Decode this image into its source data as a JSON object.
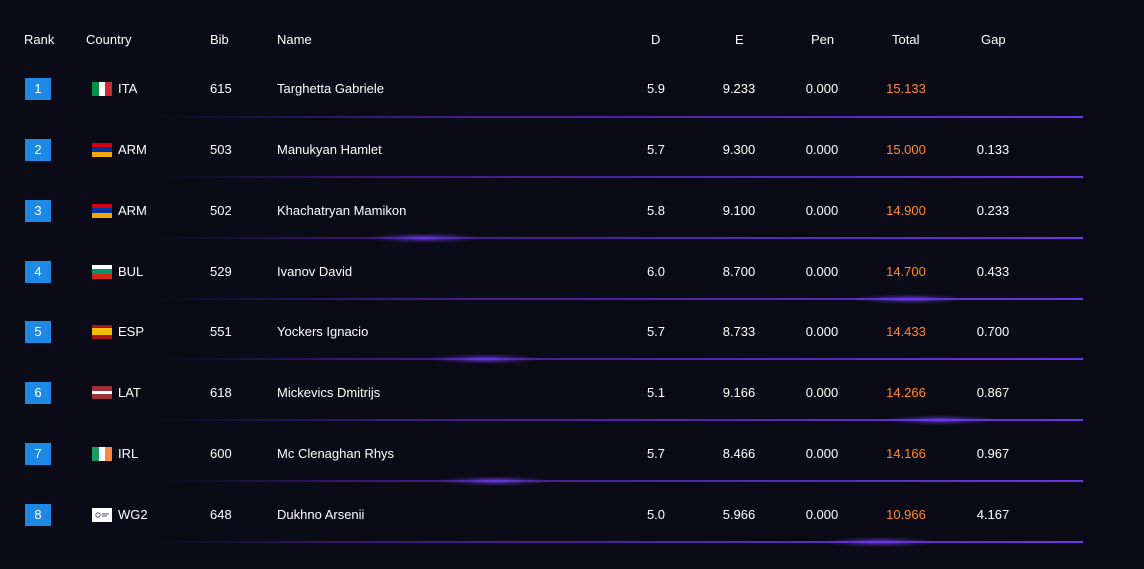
{
  "columns": {
    "rank": "Rank",
    "country": "Country",
    "bib": "Bib",
    "name": "Name",
    "d": "D",
    "e": "E",
    "pen": "Pen",
    "total": "Total",
    "gap": "Gap"
  },
  "colors": {
    "background": "#0b0b17",
    "rank_badge": "#1e88e5",
    "total_text": "#ff8a2b",
    "divider": "#6a35e8"
  },
  "rows": [
    {
      "rank": "1",
      "flag": "ITA-flag-icon",
      "country": "ITA",
      "bib": "615",
      "name": "Targhetta Gabriele",
      "d": "5.9",
      "e": "9.233",
      "pen": "0.000",
      "total": "15.133",
      "gap": ""
    },
    {
      "rank": "2",
      "flag": "ARM-flag-icon",
      "country": "ARM",
      "bib": "503",
      "name": "Manukyan Hamlet",
      "d": "5.7",
      "e": "9.300",
      "pen": "0.000",
      "total": "15.000",
      "gap": "0.133"
    },
    {
      "rank": "3",
      "flag": "ARM-flag-icon",
      "country": "ARM",
      "bib": "502",
      "name": "Khachatryan Mamikon",
      "d": "5.8",
      "e": "9.100",
      "pen": "0.000",
      "total": "14.900",
      "gap": "0.233"
    },
    {
      "rank": "4",
      "flag": "BUL-flag-icon",
      "country": "BUL",
      "bib": "529",
      "name": "Ivanov David",
      "d": "6.0",
      "e": "8.700",
      "pen": "0.000",
      "total": "14.700",
      "gap": "0.433"
    },
    {
      "rank": "5",
      "flag": "ESP-flag-icon",
      "country": "ESP",
      "bib": "551",
      "name": "Yockers Ignacio",
      "d": "5.7",
      "e": "8.733",
      "pen": "0.000",
      "total": "14.433",
      "gap": "0.700"
    },
    {
      "rank": "6",
      "flag": "LAT-flag-icon",
      "country": "LAT",
      "bib": "618",
      "name": "Mickevics Dmitrijs",
      "d": "5.1",
      "e": "9.166",
      "pen": "0.000",
      "total": "14.266",
      "gap": "0.867"
    },
    {
      "rank": "7",
      "flag": "IRL-flag-icon",
      "country": "IRL",
      "bib": "600",
      "name": "Mc Clenaghan Rhys",
      "d": "5.7",
      "e": "8.466",
      "pen": "0.000",
      "total": "14.166",
      "gap": "0.967"
    },
    {
      "rank": "8",
      "flag": "WG2-flag-icon",
      "country": "WG2",
      "bib": "648",
      "name": "Dukhno Arsenii",
      "d": "5.0",
      "e": "5.966",
      "pen": "0.000",
      "total": "10.966",
      "gap": "4.167"
    }
  ]
}
